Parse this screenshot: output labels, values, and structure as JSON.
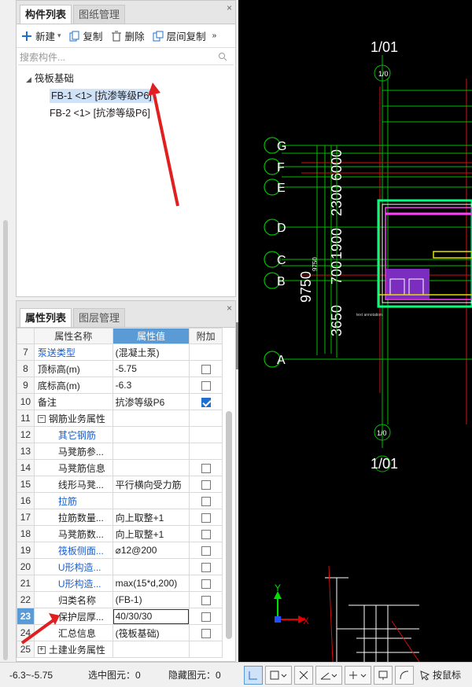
{
  "top_panel": {
    "tabs": [
      "构件列表",
      "图纸管理"
    ],
    "toolbar": {
      "new": "新建",
      "copy": "复制",
      "delete": "删除",
      "floor_copy": "层间复制",
      "more": "»"
    },
    "search_placeholder": "搜索构件...",
    "tree": {
      "group": "筏板基础",
      "items": [
        "FB-1 <1> [抗渗等级P6]",
        "FB-2 <1> [抗渗等级P6]"
      ]
    }
  },
  "bottom_panel": {
    "tabs": [
      "属性列表",
      "图层管理"
    ],
    "headers": {
      "name": "属性名称",
      "value": "属性值",
      "extra": "附加"
    },
    "rows": [
      {
        "num": "7",
        "name": "泵送类型",
        "value": "(混凝土泵)",
        "blue": true
      },
      {
        "num": "8",
        "name": "顶标高(m)",
        "value": "-5.75",
        "check": "off"
      },
      {
        "num": "9",
        "name": "底标高(m)",
        "value": "-6.3",
        "check": "off"
      },
      {
        "num": "10",
        "name": "备注",
        "value": "抗渗等级P6",
        "check": "on"
      },
      {
        "num": "11",
        "name": "钢筋业务属性",
        "value": "",
        "group": true
      },
      {
        "num": "12",
        "name": "其它钢筋",
        "value": "",
        "blue": true,
        "indent": true
      },
      {
        "num": "13",
        "name": "马凳筋参...",
        "value": "",
        "indent": true
      },
      {
        "num": "14",
        "name": "马凳筋信息",
        "value": "",
        "indent": true,
        "check": "off"
      },
      {
        "num": "15",
        "name": "线形马凳...",
        "value": "平行横向受力筋",
        "indent": true,
        "check": "off"
      },
      {
        "num": "16",
        "name": "拉筋",
        "value": "",
        "blue": true,
        "indent": true,
        "check": "off"
      },
      {
        "num": "17",
        "name": "拉筋数量...",
        "value": "向上取整+1",
        "indent": true,
        "check": "off"
      },
      {
        "num": "18",
        "name": "马凳筋数...",
        "value": "向上取整+1",
        "indent": true,
        "check": "off"
      },
      {
        "num": "19",
        "name": "筏板侧面...",
        "value": "⌀12@200",
        "blue": true,
        "indent": true,
        "check": "off"
      },
      {
        "num": "20",
        "name": "U形构造...",
        "value": "",
        "blue": true,
        "indent": true,
        "check": "off"
      },
      {
        "num": "21",
        "name": "U形构造...",
        "value": "max(15*d,200)",
        "blue": true,
        "indent": true,
        "check": "off"
      },
      {
        "num": "22",
        "name": "归类名称",
        "value": "(FB-1)",
        "indent": true,
        "check": "off"
      },
      {
        "num": "23",
        "name": "保护层厚...",
        "value": "40/30/30",
        "indent": true,
        "check": "off",
        "selected": true
      },
      {
        "num": "24",
        "name": "汇总信息",
        "value": "(筏板基础)",
        "indent": true,
        "check": "off"
      },
      {
        "num": "25",
        "name": "土建业务属性",
        "value": "",
        "group": true,
        "plus": true
      }
    ]
  },
  "cad": {
    "labels": {
      "top_axis": "1/01",
      "bottom_axis": "1/01",
      "dim1": "9750",
      "dim2": "2300",
      "dim3": "6000",
      "dim4": "1900",
      "dim5": "700",
      "dim6": "3650",
      "small1": "9750"
    },
    "grid_rows": [
      "G",
      "F",
      "E",
      "D",
      "C",
      "B",
      "A"
    ],
    "axis_y": "Y",
    "axis_x": "X"
  },
  "status": {
    "range": "-6.3~-5.75",
    "selected": "选中图元：0",
    "hidden": "隐藏图元：0",
    "last": "按鼠标"
  }
}
